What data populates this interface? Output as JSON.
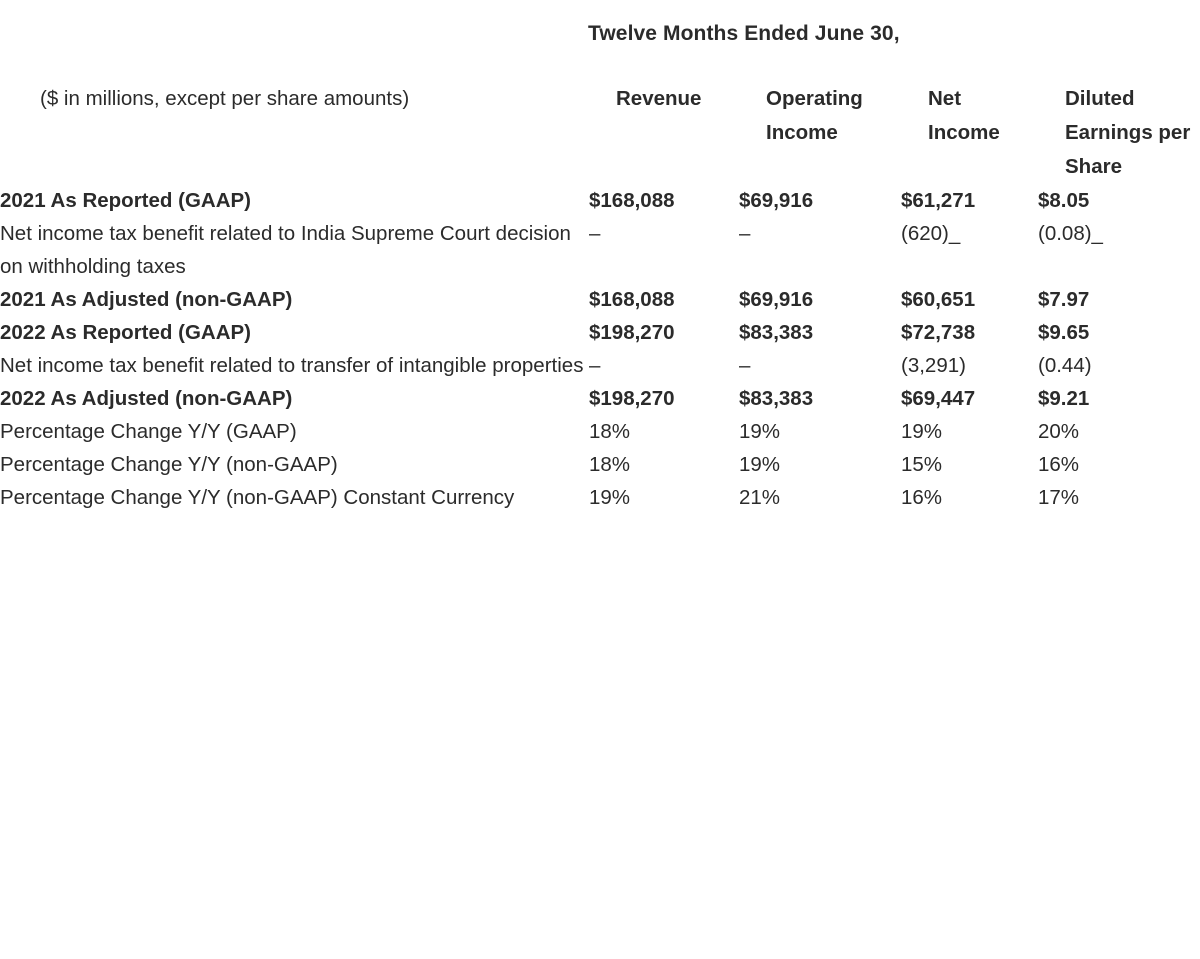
{
  "title": "Twelve Months Ended June 30,",
  "columns": {
    "label": "($ in millions, except per share amounts)",
    "revenue": "Revenue",
    "operating_income": "Operating Income",
    "net_income": "Net Income",
    "diluted_eps": "Diluted Earnings per Share"
  },
  "rows": [
    {
      "label": "2021 As Reported (GAAP)",
      "revenue": "$168,088",
      "operating_income": "$69,916",
      "net_income": "$61,271",
      "diluted_eps": "$8.05",
      "emphasis": "bold"
    },
    {
      "label": "Net income tax benefit related to India Supreme Court decision on withholding taxes",
      "revenue": "–",
      "operating_income": "–",
      "net_income": "(620)_",
      "diluted_eps": "(0.08)_",
      "emphasis": "normal"
    },
    {
      "label": "2021 As Adjusted (non-GAAP)",
      "revenue": "$168,088",
      "operating_income": "$69,916",
      "net_income": "$60,651",
      "diluted_eps": "$7.97",
      "emphasis": "bold"
    },
    {
      "label": "2022 As Reported (GAAP)",
      "revenue": "$198,270",
      "operating_income": "$83,383",
      "net_income": "$72,738",
      "diluted_eps": "$9.65",
      "emphasis": "bold"
    },
    {
      "label": "Net income tax benefit related to transfer of intangible properties",
      "revenue": "–",
      "operating_income": "–",
      "net_income": "(3,291)",
      "diluted_eps": "(0.44)",
      "emphasis": "normal"
    },
    {
      "label": "2022 As Adjusted (non-GAAP)",
      "revenue": "$198,270",
      "operating_income": "$83,383",
      "net_income": "$69,447",
      "diluted_eps": "$9.21",
      "emphasis": "bold"
    },
    {
      "label": "Percentage Change Y/Y (GAAP)",
      "revenue": "18%",
      "operating_income": "19%",
      "net_income": "19%",
      "diluted_eps": "20%",
      "emphasis": "normal"
    },
    {
      "label": "Percentage Change Y/Y (non-GAAP)",
      "revenue": "18%",
      "operating_income": "19%",
      "net_income": "15%",
      "diluted_eps": "16%",
      "emphasis": "normal"
    },
    {
      "label": "Percentage Change Y/Y (non-GAAP) Constant Currency",
      "revenue": "19%",
      "operating_income": "21%",
      "net_income": "16%",
      "diluted_eps": "17%",
      "emphasis": "normal"
    }
  ],
  "colors": {
    "text": "#2b2b2b",
    "background": "#ffffff"
  }
}
